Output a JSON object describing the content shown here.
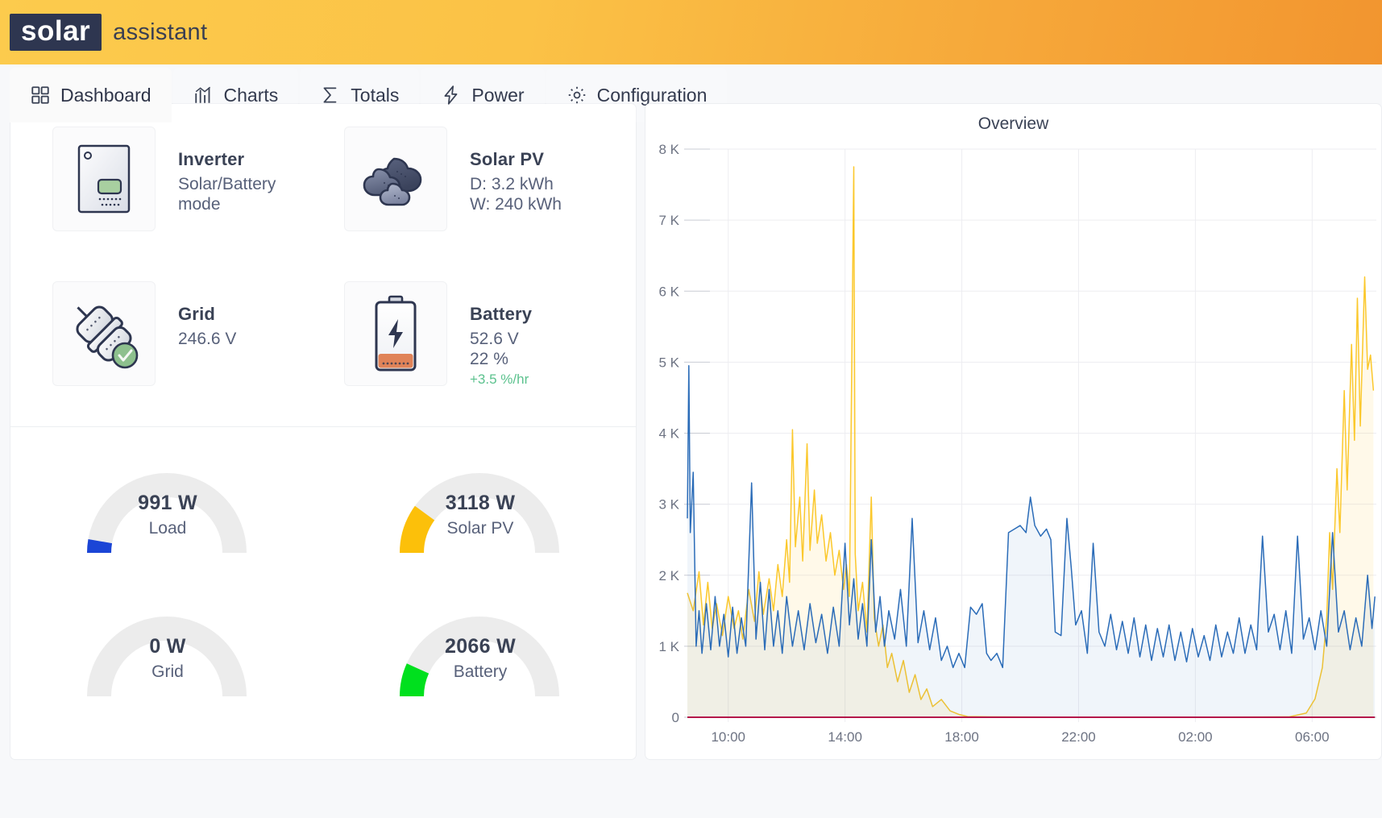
{
  "app": {
    "logo_main": "solar",
    "logo_sub": "assistant",
    "brand_dark": "#2e3650",
    "brand_amber": "#fbc246"
  },
  "nav": {
    "tabs": [
      {
        "label": "Dashboard",
        "icon": "grid-icon",
        "active": true
      },
      {
        "label": "Charts",
        "icon": "bar-chart-icon",
        "active": false
      },
      {
        "label": "Totals",
        "icon": "sigma-icon",
        "active": false
      },
      {
        "label": "Power",
        "icon": "bolt-icon",
        "active": false
      },
      {
        "label": "Configuration",
        "icon": "gear-icon",
        "active": false
      }
    ]
  },
  "status_tiles": [
    {
      "name": "inverter",
      "icon": "inverter-icon",
      "title": "Inverter",
      "lines": [
        "Solar/Battery",
        "mode"
      ],
      "accent_line": null
    },
    {
      "name": "solar-pv",
      "icon": "cloud-icon",
      "title": "Solar PV",
      "lines": [
        "D: 3.2 kWh",
        "W: 240 kWh"
      ],
      "accent_line": null
    },
    {
      "name": "grid",
      "icon": "plug-connected-icon",
      "title": "Grid",
      "lines": [
        "246.6 V"
      ],
      "accent_line": null
    },
    {
      "name": "battery",
      "icon": "battery-icon",
      "title": "Battery",
      "lines": [
        "52.6 V",
        "22 %"
      ],
      "accent_line": "+3.5 %/hr"
    }
  ],
  "gauges": [
    {
      "name": "load",
      "value": "991 W",
      "label": "Load",
      "color": "#1b45d6",
      "fraction": 0.055,
      "track": "#ececec"
    },
    {
      "name": "solar-pv",
      "value": "3118 W",
      "label": "Solar PV",
      "color": "#fcc00a",
      "fraction": 0.2,
      "track": "#ececec"
    },
    {
      "name": "grid",
      "value": "0 W",
      "label": "Grid",
      "color": "#1b45d6",
      "fraction": 0.0,
      "track": "#ececec"
    },
    {
      "name": "battery",
      "value": "2066 W",
      "label": "Battery",
      "color": "#00e01e",
      "fraction": 0.135,
      "track": "#ececec"
    }
  ],
  "chart_data": {
    "type": "line",
    "title": "Overview",
    "xlabel": "",
    "ylabel": "",
    "ylim": [
      0,
      8000
    ],
    "yticks": [
      0,
      1000,
      2000,
      3000,
      4000,
      5000,
      6000,
      7000,
      8000
    ],
    "ytick_labels": [
      "0",
      "1 K",
      "2 K",
      "3 K",
      "4 K",
      "5 K",
      "6 K",
      "7 K",
      "8 K"
    ],
    "xtick_labels": [
      "10:00",
      "14:00",
      "18:00",
      "22:00",
      "02:00",
      "06:00"
    ],
    "xtick_hours": [
      10,
      14,
      18,
      22,
      26,
      30
    ],
    "xlim_hours": [
      8.6,
      32.2
    ],
    "grid": true,
    "legend": "none",
    "series": [
      {
        "name": "Solar PV",
        "color": "#fbc82c",
        "fill": "rgba(251,200,44,0.10)",
        "points": [
          [
            8.6,
            1750
          ],
          [
            8.8,
            1500
          ],
          [
            9.0,
            2050
          ],
          [
            9.15,
            1300
          ],
          [
            9.3,
            1900
          ],
          [
            9.45,
            1250
          ],
          [
            9.6,
            1600
          ],
          [
            9.8,
            1150
          ],
          [
            10.0,
            1700
          ],
          [
            10.2,
            1250
          ],
          [
            10.35,
            1500
          ],
          [
            10.5,
            1100
          ],
          [
            10.7,
            1800
          ],
          [
            10.9,
            1350
          ],
          [
            11.05,
            2050
          ],
          [
            11.2,
            1450
          ],
          [
            11.4,
            1950
          ],
          [
            11.55,
            1500
          ],
          [
            11.7,
            2150
          ],
          [
            11.85,
            1700
          ],
          [
            12.0,
            2500
          ],
          [
            12.1,
            1900
          ],
          [
            12.2,
            4050
          ],
          [
            12.3,
            2400
          ],
          [
            12.45,
            3100
          ],
          [
            12.55,
            2200
          ],
          [
            12.7,
            3850
          ],
          [
            12.8,
            2350
          ],
          [
            12.95,
            3200
          ],
          [
            13.05,
            2450
          ],
          [
            13.2,
            2850
          ],
          [
            13.35,
            2200
          ],
          [
            13.5,
            2600
          ],
          [
            13.65,
            2000
          ],
          [
            13.8,
            2350
          ],
          [
            13.95,
            1800
          ],
          [
            14.05,
            2150
          ],
          [
            14.15,
            1700
          ],
          [
            14.3,
            7750
          ],
          [
            14.35,
            2300
          ],
          [
            14.45,
            1500
          ],
          [
            14.6,
            1900
          ],
          [
            14.75,
            1200
          ],
          [
            14.9,
            3100
          ],
          [
            15.0,
            1400
          ],
          [
            15.15,
            1000
          ],
          [
            15.3,
            1300
          ],
          [
            15.45,
            700
          ],
          [
            15.6,
            900
          ],
          [
            15.8,
            500
          ],
          [
            16.0,
            800
          ],
          [
            16.2,
            350
          ],
          [
            16.4,
            600
          ],
          [
            16.6,
            250
          ],
          [
            16.8,
            400
          ],
          [
            17.0,
            150
          ],
          [
            17.3,
            250
          ],
          [
            17.6,
            90
          ],
          [
            17.9,
            40
          ],
          [
            18.2,
            10
          ],
          [
            19,
            5
          ],
          [
            21,
            3
          ],
          [
            24,
            3
          ],
          [
            27,
            3
          ],
          [
            29.2,
            5
          ],
          [
            29.8,
            60
          ],
          [
            30.1,
            260
          ],
          [
            30.35,
            700
          ],
          [
            30.5,
            1400
          ],
          [
            30.6,
            2600
          ],
          [
            30.7,
            1800
          ],
          [
            30.85,
            3500
          ],
          [
            30.95,
            2600
          ],
          [
            31.1,
            4600
          ],
          [
            31.2,
            3200
          ],
          [
            31.35,
            5250
          ],
          [
            31.45,
            3900
          ],
          [
            31.55,
            5900
          ],
          [
            31.65,
            4100
          ],
          [
            31.8,
            6200
          ],
          [
            31.9,
            4900
          ],
          [
            32.0,
            5100
          ],
          [
            32.1,
            4600
          ]
        ]
      },
      {
        "name": "Load",
        "color": "#2b6cb8",
        "fill": "rgba(43,108,184,0.07)",
        "points": [
          [
            8.6,
            2800
          ],
          [
            8.65,
            4950
          ],
          [
            8.7,
            2600
          ],
          [
            8.8,
            3450
          ],
          [
            8.9,
            1000
          ],
          [
            9.0,
            1500
          ],
          [
            9.1,
            900
          ],
          [
            9.25,
            1600
          ],
          [
            9.4,
            950
          ],
          [
            9.55,
            1700
          ],
          [
            9.7,
            1000
          ],
          [
            9.85,
            1450
          ],
          [
            10.0,
            850
          ],
          [
            10.15,
            1550
          ],
          [
            10.3,
            900
          ],
          [
            10.45,
            1400
          ],
          [
            10.6,
            1000
          ],
          [
            10.8,
            3300
          ],
          [
            10.95,
            1100
          ],
          [
            11.1,
            1900
          ],
          [
            11.25,
            950
          ],
          [
            11.4,
            1800
          ],
          [
            11.55,
            1000
          ],
          [
            11.7,
            1500
          ],
          [
            11.85,
            900
          ],
          [
            12.0,
            1700
          ],
          [
            12.2,
            1000
          ],
          [
            12.4,
            1500
          ],
          [
            12.6,
            950
          ],
          [
            12.8,
            1600
          ],
          [
            13.0,
            1050
          ],
          [
            13.2,
            1450
          ],
          [
            13.4,
            900
          ],
          [
            13.6,
            1550
          ],
          [
            13.8,
            1000
          ],
          [
            14.0,
            2450
          ],
          [
            14.15,
            1300
          ],
          [
            14.3,
            1950
          ],
          [
            14.45,
            1100
          ],
          [
            14.6,
            1600
          ],
          [
            14.75,
            1000
          ],
          [
            14.9,
            2500
          ],
          [
            15.05,
            1200
          ],
          [
            15.2,
            1700
          ],
          [
            15.35,
            1000
          ],
          [
            15.5,
            1500
          ],
          [
            15.7,
            1100
          ],
          [
            15.9,
            1800
          ],
          [
            16.1,
            1000
          ],
          [
            16.3,
            2800
          ],
          [
            16.5,
            1050
          ],
          [
            16.7,
            1500
          ],
          [
            16.9,
            950
          ],
          [
            17.1,
            1400
          ],
          [
            17.3,
            800
          ],
          [
            17.5,
            1000
          ],
          [
            17.7,
            700
          ],
          [
            17.9,
            900
          ],
          [
            18.1,
            700
          ],
          [
            18.3,
            1550
          ],
          [
            18.5,
            1450
          ],
          [
            18.7,
            1600
          ],
          [
            18.85,
            900
          ],
          [
            19.0,
            800
          ],
          [
            19.2,
            900
          ],
          [
            19.4,
            700
          ],
          [
            19.6,
            2600
          ],
          [
            19.8,
            2650
          ],
          [
            20.0,
            2700
          ],
          [
            20.2,
            2600
          ],
          [
            20.35,
            3100
          ],
          [
            20.5,
            2700
          ],
          [
            20.7,
            2550
          ],
          [
            20.9,
            2650
          ],
          [
            21.05,
            2500
          ],
          [
            21.2,
            1200
          ],
          [
            21.4,
            1150
          ],
          [
            21.6,
            2800
          ],
          [
            21.75,
            2100
          ],
          [
            21.9,
            1300
          ],
          [
            22.1,
            1500
          ],
          [
            22.3,
            900
          ],
          [
            22.5,
            2450
          ],
          [
            22.7,
            1200
          ],
          [
            22.9,
            1000
          ],
          [
            23.1,
            1450
          ],
          [
            23.3,
            950
          ],
          [
            23.5,
            1350
          ],
          [
            23.7,
            900
          ],
          [
            23.9,
            1400
          ],
          [
            24.1,
            850
          ],
          [
            24.3,
            1300
          ],
          [
            24.5,
            800
          ],
          [
            24.7,
            1250
          ],
          [
            24.9,
            850
          ],
          [
            25.1,
            1300
          ],
          [
            25.3,
            800
          ],
          [
            25.5,
            1200
          ],
          [
            25.7,
            780
          ],
          [
            25.9,
            1250
          ],
          [
            26.1,
            850
          ],
          [
            26.3,
            1150
          ],
          [
            26.5,
            800
          ],
          [
            26.7,
            1300
          ],
          [
            26.9,
            850
          ],
          [
            27.1,
            1200
          ],
          [
            27.3,
            900
          ],
          [
            27.5,
            1400
          ],
          [
            27.7,
            900
          ],
          [
            27.9,
            1300
          ],
          [
            28.1,
            950
          ],
          [
            28.3,
            2550
          ],
          [
            28.5,
            1200
          ],
          [
            28.7,
            1450
          ],
          [
            28.9,
            950
          ],
          [
            29.1,
            1500
          ],
          [
            29.3,
            900
          ],
          [
            29.5,
            2550
          ],
          [
            29.7,
            1100
          ],
          [
            29.9,
            1400
          ],
          [
            30.1,
            950
          ],
          [
            30.3,
            1500
          ],
          [
            30.5,
            1000
          ],
          [
            30.7,
            2600
          ],
          [
            30.9,
            1200
          ],
          [
            31.1,
            1500
          ],
          [
            31.3,
            950
          ],
          [
            31.5,
            1400
          ],
          [
            31.7,
            1000
          ],
          [
            31.9,
            2000
          ],
          [
            32.05,
            1250
          ],
          [
            32.15,
            1700
          ]
        ]
      },
      {
        "name": "Grid",
        "color": "#b4184a",
        "fill": "none",
        "points": [
          [
            8.6,
            0
          ],
          [
            12,
            0
          ],
          [
            16,
            0
          ],
          [
            18,
            0
          ],
          [
            20,
            0
          ],
          [
            24,
            0
          ],
          [
            28,
            0
          ],
          [
            30,
            0
          ],
          [
            32.15,
            0
          ]
        ]
      }
    ]
  }
}
